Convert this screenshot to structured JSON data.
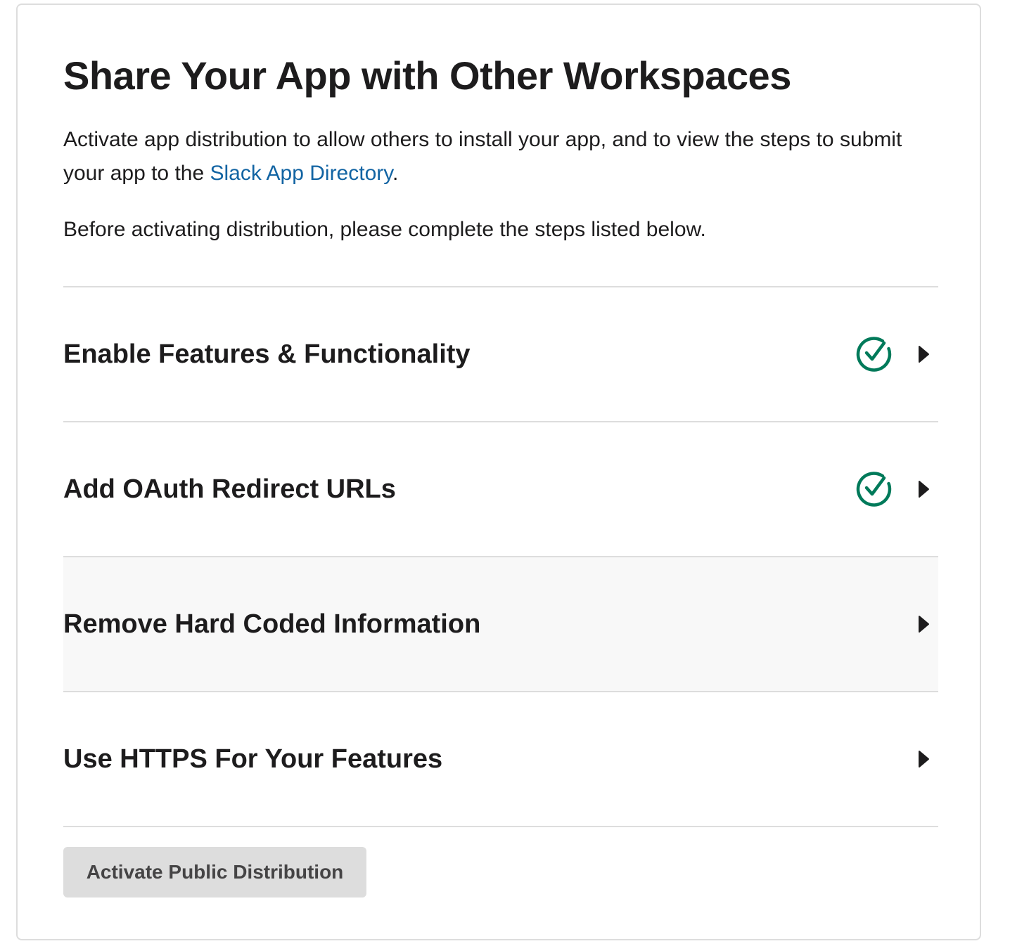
{
  "page": {
    "title": "Share Your App with Other Workspaces",
    "description_before_link": "Activate app distribution to allow others to install your app, and to view the steps to submit your app to the ",
    "description_link": "Slack App Directory",
    "description_after_link": ".",
    "note": "Before activating distribution, please complete the steps listed below."
  },
  "steps": [
    {
      "label": "Enable Features & Functionality",
      "completed": true
    },
    {
      "label": "Add OAuth Redirect URLs",
      "completed": true
    },
    {
      "label": "Remove Hard Coded Information",
      "completed": false
    },
    {
      "label": "Use HTTPS For Your Features",
      "completed": false
    }
  ],
  "actions": {
    "activate_label": "Activate Public Distribution"
  },
  "colors": {
    "link": "#1264a3",
    "check": "#007a5a",
    "divider": "#dddddd",
    "button_bg": "#dddddd",
    "hover_row": "#f8f8f8"
  },
  "icons": {
    "completed": "check-circle-icon",
    "expand": "caret-right-icon"
  }
}
